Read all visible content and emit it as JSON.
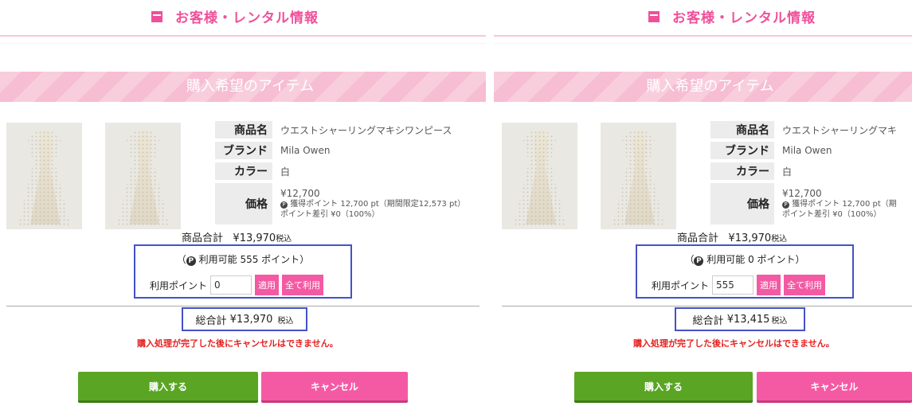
{
  "header": {
    "title": "お客様・レンタル情報"
  },
  "banner": {
    "title": "購入希望のアイテム"
  },
  "labels": {
    "name": "商品名",
    "brand": "ブランド",
    "color": "カラー",
    "price": "価格",
    "use_points": "利用ポイント",
    "apply": "適用",
    "use_all": "全て利用",
    "warning": "購入処理が完了した後にキャンセルはできません。",
    "buy": "購入する",
    "cancel": "キャンセル",
    "tax_incl": "税込",
    "point_badge": "P"
  },
  "product": {
    "name": "ウエストシャーリングマキシワンピース",
    "name_truncated": "ウエストシャーリングマキ",
    "brand": "Mila Owen",
    "color": "白",
    "price": "¥12,700",
    "points_earned": "獲得ポイント 12,700 pt（期間限定12,573 pt）",
    "points_earned_truncated": "獲得ポイント 12,700 pt（期",
    "point_discount": "ポイント差引 ¥0（100%）"
  },
  "left": {
    "subtotal_label": "商品合計",
    "subtotal_value": "¥13,970",
    "available_points": "利用可能 555 ポイント",
    "points_input": "0",
    "total_label": "総合計",
    "total_value": "¥13,970"
  },
  "right": {
    "subtotal_label": "商品合計",
    "subtotal_value": "¥13,970",
    "available_points": "利用可能 0 ポイント",
    "points_input": "555",
    "total_label": "総合計",
    "total_value": "¥13,415"
  },
  "colors": {
    "accent": "#f0509a",
    "highlight_box": "#4452c8",
    "buy": "#5aa524",
    "cancel": "#f45aa3",
    "warning": "#e62020"
  }
}
